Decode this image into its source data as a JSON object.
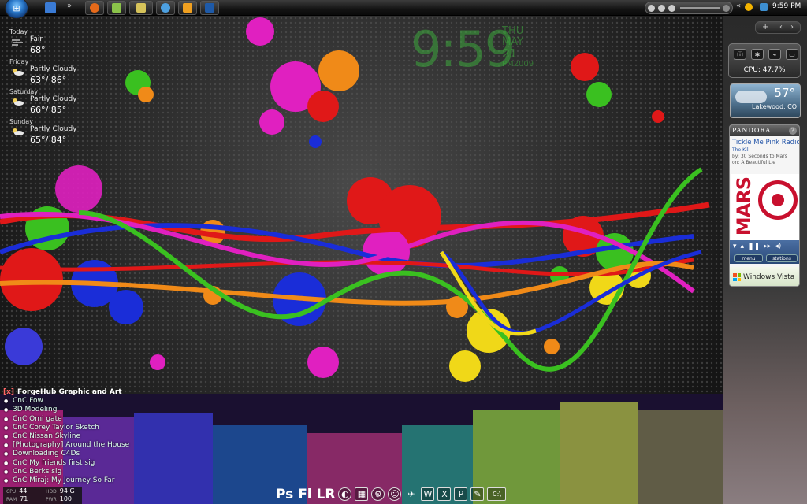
{
  "taskbar": {
    "clock": "9:59 PM",
    "overflow_glyph": "»",
    "back_glyph": "«",
    "colors": {
      "start_orb": "#2a78c9"
    }
  },
  "clock_gadget": {
    "time": "9:59",
    "day": "THU",
    "month": "MAY",
    "date": "21",
    "ampm_year": "PM2009"
  },
  "weather_gadget": {
    "days": [
      {
        "day": "Today",
        "condition": "Fair",
        "temp": "68°",
        "icon": "wind-icon"
      },
      {
        "day": "Friday",
        "condition": "Partly Cloudy",
        "temp": "63°/ 86°",
        "icon": "partly-cloudy-icon"
      },
      {
        "day": "Saturday",
        "condition": "Partly Cloudy",
        "temp": "66°/ 85°",
        "icon": "partly-cloudy-icon"
      },
      {
        "day": "Sunday",
        "condition": "Partly Cloudy",
        "temp": "65°/ 84°",
        "icon": "partly-cloudy-icon"
      }
    ]
  },
  "rss_gadget": {
    "close_glyph": "[x]",
    "title": "ForgeHub Graphic and Art",
    "items": [
      "CnC Fow",
      "3D Modeling",
      "CnC Omi gate",
      "CnC Corey Taylor Sketch",
      "CnC Nissan Skyline",
      "[Photography] Around the House",
      "Downloading C4Ds",
      "CnC My friends first sig",
      "CnC Berks sig",
      "CnC Miraj: My Journey So Far"
    ]
  },
  "sysmon": {
    "cpu_label": "CPU",
    "cpu_value": "44",
    "ram_label": "RAM",
    "ram_value": "71",
    "hdd_label": "HDD",
    "hdd_value": "94 G",
    "pwr_label": "PWR",
    "pwr_value": "100"
  },
  "dock": {
    "text_icons": "Ps Fl LR",
    "icons": [
      "firefox-icon",
      "calculator-icon",
      "steam-icon",
      "messenger-icon",
      "paint-icon",
      "word-icon",
      "excel-icon",
      "publisher-icon",
      "notepad-icon",
      "cmd-icon"
    ],
    "labels": {
      "word": "W",
      "excel": "X",
      "publisher": "P",
      "cmd": "C:\\"
    }
  },
  "sidebar": {
    "add_glyph": "+",
    "nav_prev": "‹",
    "nav_next": "›",
    "cpu_meter": {
      "label": "CPU: 47.7%",
      "percent": 47.7
    },
    "weather": {
      "temp": "57°",
      "location": "Lakewood, CO"
    },
    "pandora": {
      "brand": "PANDORA",
      "help": "?",
      "station": "Tickle Me Pink Radio",
      "song": "The Kill",
      "artist_line": "by: 30 Seconds to Mars",
      "album_line": "on: A Beautiful Lie",
      "art_text": "MARS",
      "menu_label": "menu",
      "stations_label": "stations"
    },
    "windows_vista": "Windows Vista"
  }
}
